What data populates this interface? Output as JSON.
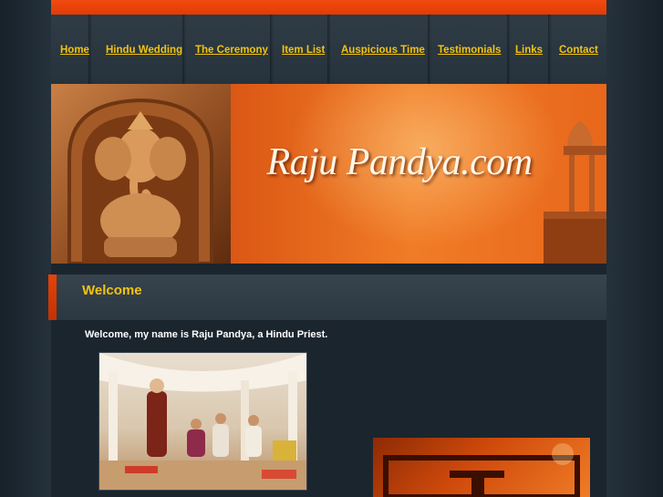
{
  "nav": {
    "items": [
      {
        "label": "Home"
      },
      {
        "label": "Hindu Wedding"
      },
      {
        "label": "The Ceremony"
      },
      {
        "label": "Item List"
      },
      {
        "label": "Auspicious Time"
      },
      {
        "label": "Testimonials"
      },
      {
        "label": "Links"
      },
      {
        "label": "Contact"
      }
    ]
  },
  "banner": {
    "site_title": "Raju Pandya.com"
  },
  "main": {
    "heading": "Welcome",
    "intro": "Welcome, my name is Raju Pandya, a Hindu Priest."
  },
  "colors": {
    "accent": "#e84a0c",
    "link": "#f1c40f",
    "background": "#1f2a33"
  }
}
